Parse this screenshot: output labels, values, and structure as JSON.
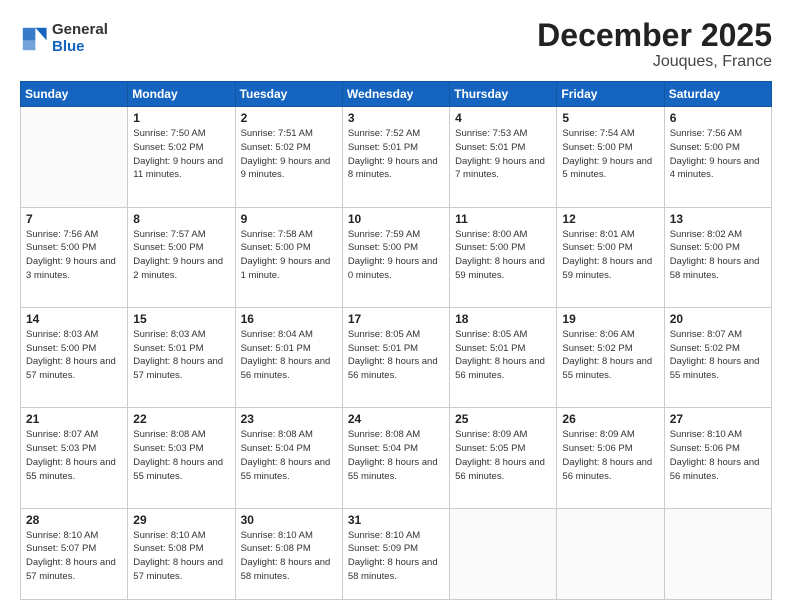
{
  "header": {
    "title": "December 2025",
    "subtitle": "Jouques, France",
    "logo_general": "General",
    "logo_blue": "Blue"
  },
  "calendar": {
    "days_of_week": [
      "Sunday",
      "Monday",
      "Tuesday",
      "Wednesday",
      "Thursday",
      "Friday",
      "Saturday"
    ],
    "weeks": [
      [
        {
          "day": "",
          "info": ""
        },
        {
          "day": "1",
          "info": "Sunrise: 7:50 AM\nSunset: 5:02 PM\nDaylight: 9 hours\nand 11 minutes."
        },
        {
          "day": "2",
          "info": "Sunrise: 7:51 AM\nSunset: 5:02 PM\nDaylight: 9 hours\nand 9 minutes."
        },
        {
          "day": "3",
          "info": "Sunrise: 7:52 AM\nSunset: 5:01 PM\nDaylight: 9 hours\nand 8 minutes."
        },
        {
          "day": "4",
          "info": "Sunrise: 7:53 AM\nSunset: 5:01 PM\nDaylight: 9 hours\nand 7 minutes."
        },
        {
          "day": "5",
          "info": "Sunrise: 7:54 AM\nSunset: 5:00 PM\nDaylight: 9 hours\nand 5 minutes."
        },
        {
          "day": "6",
          "info": "Sunrise: 7:56 AM\nSunset: 5:00 PM\nDaylight: 9 hours\nand 4 minutes."
        }
      ],
      [
        {
          "day": "7",
          "info": "Sunrise: 7:56 AM\nSunset: 5:00 PM\nDaylight: 9 hours\nand 3 minutes."
        },
        {
          "day": "8",
          "info": "Sunrise: 7:57 AM\nSunset: 5:00 PM\nDaylight: 9 hours\nand 2 minutes."
        },
        {
          "day": "9",
          "info": "Sunrise: 7:58 AM\nSunset: 5:00 PM\nDaylight: 9 hours\nand 1 minute."
        },
        {
          "day": "10",
          "info": "Sunrise: 7:59 AM\nSunset: 5:00 PM\nDaylight: 9 hours\nand 0 minutes."
        },
        {
          "day": "11",
          "info": "Sunrise: 8:00 AM\nSunset: 5:00 PM\nDaylight: 8 hours\nand 59 minutes."
        },
        {
          "day": "12",
          "info": "Sunrise: 8:01 AM\nSunset: 5:00 PM\nDaylight: 8 hours\nand 59 minutes."
        },
        {
          "day": "13",
          "info": "Sunrise: 8:02 AM\nSunset: 5:00 PM\nDaylight: 8 hours\nand 58 minutes."
        }
      ],
      [
        {
          "day": "14",
          "info": "Sunrise: 8:03 AM\nSunset: 5:00 PM\nDaylight: 8 hours\nand 57 minutes."
        },
        {
          "day": "15",
          "info": "Sunrise: 8:03 AM\nSunset: 5:01 PM\nDaylight: 8 hours\nand 57 minutes."
        },
        {
          "day": "16",
          "info": "Sunrise: 8:04 AM\nSunset: 5:01 PM\nDaylight: 8 hours\nand 56 minutes."
        },
        {
          "day": "17",
          "info": "Sunrise: 8:05 AM\nSunset: 5:01 PM\nDaylight: 8 hours\nand 56 minutes."
        },
        {
          "day": "18",
          "info": "Sunrise: 8:05 AM\nSunset: 5:01 PM\nDaylight: 8 hours\nand 56 minutes."
        },
        {
          "day": "19",
          "info": "Sunrise: 8:06 AM\nSunset: 5:02 PM\nDaylight: 8 hours\nand 55 minutes."
        },
        {
          "day": "20",
          "info": "Sunrise: 8:07 AM\nSunset: 5:02 PM\nDaylight: 8 hours\nand 55 minutes."
        }
      ],
      [
        {
          "day": "21",
          "info": "Sunrise: 8:07 AM\nSunset: 5:03 PM\nDaylight: 8 hours\nand 55 minutes."
        },
        {
          "day": "22",
          "info": "Sunrise: 8:08 AM\nSunset: 5:03 PM\nDaylight: 8 hours\nand 55 minutes."
        },
        {
          "day": "23",
          "info": "Sunrise: 8:08 AM\nSunset: 5:04 PM\nDaylight: 8 hours\nand 55 minutes."
        },
        {
          "day": "24",
          "info": "Sunrise: 8:08 AM\nSunset: 5:04 PM\nDaylight: 8 hours\nand 55 minutes."
        },
        {
          "day": "25",
          "info": "Sunrise: 8:09 AM\nSunset: 5:05 PM\nDaylight: 8 hours\nand 56 minutes."
        },
        {
          "day": "26",
          "info": "Sunrise: 8:09 AM\nSunset: 5:06 PM\nDaylight: 8 hours\nand 56 minutes."
        },
        {
          "day": "27",
          "info": "Sunrise: 8:10 AM\nSunset: 5:06 PM\nDaylight: 8 hours\nand 56 minutes."
        }
      ],
      [
        {
          "day": "28",
          "info": "Sunrise: 8:10 AM\nSunset: 5:07 PM\nDaylight: 8 hours\nand 57 minutes."
        },
        {
          "day": "29",
          "info": "Sunrise: 8:10 AM\nSunset: 5:08 PM\nDaylight: 8 hours\nand 57 minutes."
        },
        {
          "day": "30",
          "info": "Sunrise: 8:10 AM\nSunset: 5:08 PM\nDaylight: 8 hours\nand 58 minutes."
        },
        {
          "day": "31",
          "info": "Sunrise: 8:10 AM\nSunset: 5:09 PM\nDaylight: 8 hours\nand 58 minutes."
        },
        {
          "day": "",
          "info": ""
        },
        {
          "day": "",
          "info": ""
        },
        {
          "day": "",
          "info": ""
        }
      ]
    ]
  }
}
